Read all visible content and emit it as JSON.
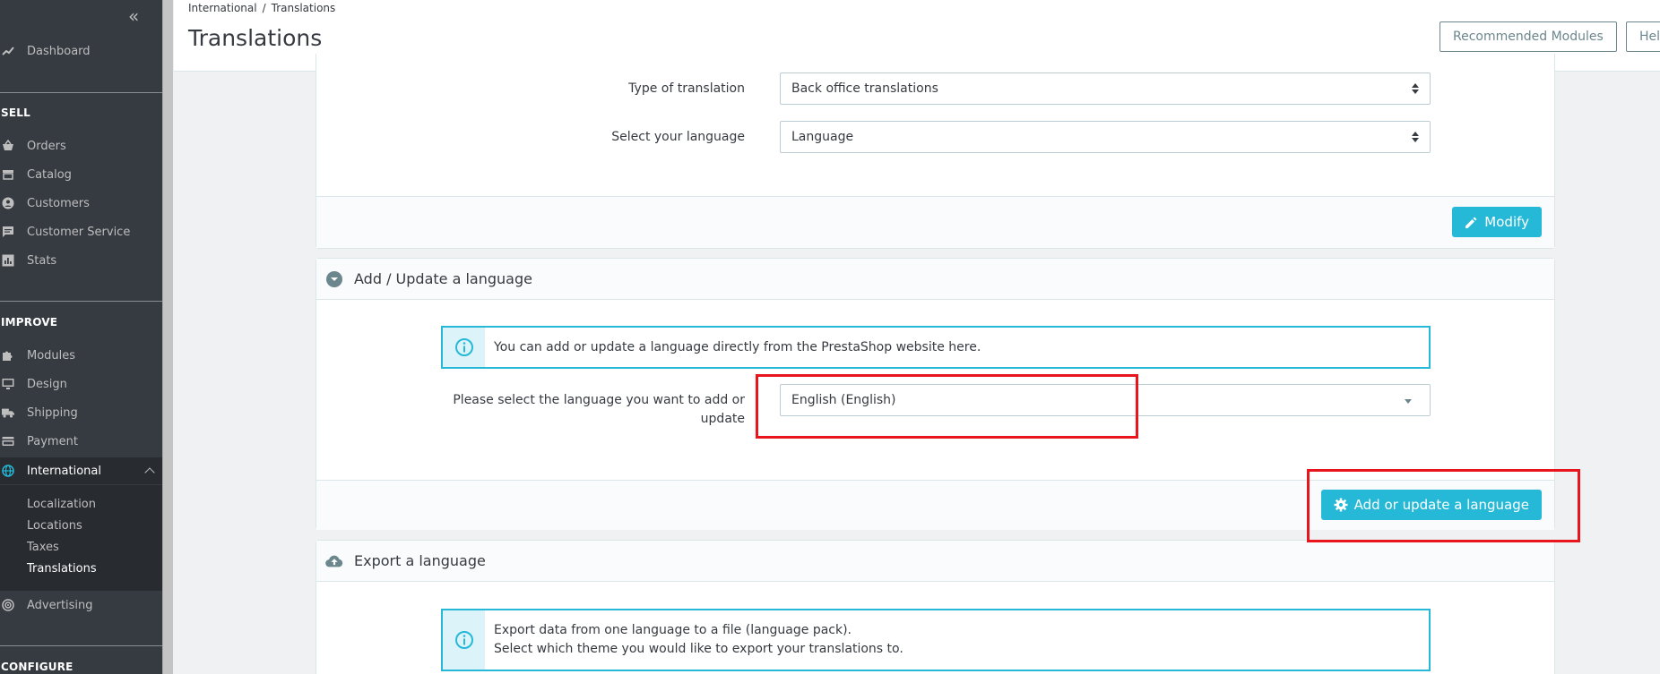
{
  "sidebar": {
    "dashboard": "Dashboard",
    "sections": {
      "sell": "SELL",
      "improve": "IMPROVE",
      "configure": "CONFIGURE"
    },
    "sell_items": [
      "Orders",
      "Catalog",
      "Customers",
      "Customer Service",
      "Stats"
    ],
    "improve_items": [
      "Modules",
      "Design",
      "Shipping",
      "Payment",
      "International"
    ],
    "international_sub": [
      "Localization",
      "Locations",
      "Taxes",
      "Translations"
    ],
    "advertising": "Advertising"
  },
  "header": {
    "breadcrumb": [
      "International",
      "Translations"
    ],
    "title": "Translations",
    "recommended_modules": "Recommended Modules",
    "help": "Help"
  },
  "modify_panel": {
    "type_label": "Type of translation",
    "type_value": "Back office translations",
    "language_label": "Select your language",
    "language_value": "Language",
    "modify_button": "Modify"
  },
  "add_panel": {
    "title": "Add / Update a language",
    "info": "You can add or update a language directly from the PrestaShop website here.",
    "select_label_line1": "Please select the language you want to add or",
    "select_label_line2": "update",
    "select_value": "English (English)",
    "add_button": "Add or update a language"
  },
  "export_panel": {
    "title": "Export a language",
    "info_line1": "Export data from one language to a file (language pack).",
    "info_line2": "Select which theme you would like to export your translations to."
  },
  "colors": {
    "accent": "#25b9d7",
    "sidebar_bg": "#363a41",
    "highlight": "#e8151d"
  }
}
